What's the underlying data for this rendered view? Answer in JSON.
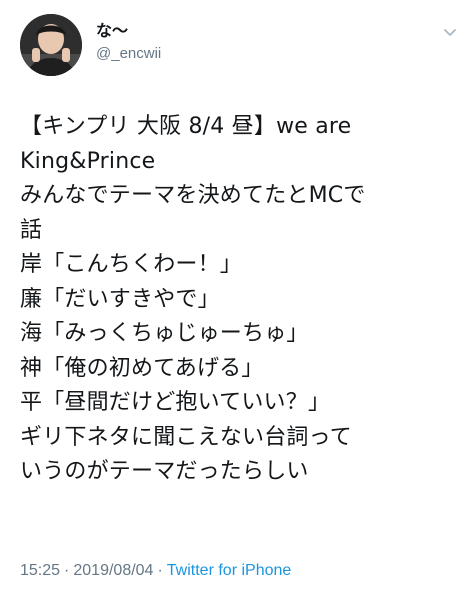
{
  "author": {
    "display_name": "な〜",
    "handle": "@_encwii",
    "avatar_icon": "user-avatar-icon"
  },
  "menu": {
    "icon": "chevron-down-icon"
  },
  "tweet": {
    "lines": [
      "【キンプリ 大阪 8/4 昼】we are",
      "King&Prince",
      "みんなでテーマを決めてたとMCで",
      "話",
      "岸「こんちくわー！」",
      "廉「だいすきやで」",
      "海「みっくちゅじゅーちゅ」",
      "神「俺の初めてあげる」",
      "平「昼間だけど抱いていい？」",
      "ギリ下ネタに聞こえない台詞って",
      "いうのがテーマだったらしい"
    ]
  },
  "meta": {
    "time": "15:25",
    "separator": "·",
    "date": "2019/08/04",
    "source": "Twitter for iPhone"
  },
  "colors": {
    "text": "#14171a",
    "secondary": "#657786",
    "link": "#1b95e0"
  }
}
